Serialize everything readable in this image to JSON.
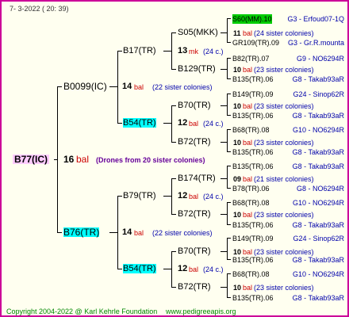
{
  "header": {
    "date": "7-  3-2022 ( 20: 39)"
  },
  "footer": {
    "copyright": "Copyright 2004-2022 @ Karl Kehrle Foundation",
    "url": "www.pedigreeapis.org"
  },
  "colors": {
    "border": "#cc0099",
    "background": "#fffff0",
    "highlight_cyan": "#00ffff",
    "highlight_green": "#00cc00",
    "highlight_pink": "#ffccff"
  },
  "root": {
    "name": "B77(IC)",
    "gen": "16",
    "unit": "bal",
    "note": "(Drones from 20 sister colonies)"
  },
  "gen1": [
    {
      "name": "B0099(IC)",
      "gen": "14",
      "unit": "bal",
      "note": "(22 sister colonies)"
    },
    {
      "name": "B76(TR)",
      "gen": "14",
      "unit": "bal",
      "note": "(22 sister colonies)"
    }
  ],
  "gen2": [
    {
      "name": "B17(TR)",
      "gen": "13",
      "unit": "mk",
      "note": "(24 c.)"
    },
    {
      "name": "B54(TR)",
      "gen": "12",
      "unit": "bal",
      "note": "(24 c.)"
    },
    {
      "name": "B79(TR)",
      "gen": "12",
      "unit": "bal",
      "note": "(24 c.)"
    },
    {
      "name": "B54(TR)",
      "gen": "12",
      "unit": "bal",
      "note": "(24 c.)"
    }
  ],
  "gen3": [
    {
      "name": "S05(MKK)",
      "gen": "11",
      "unit": "bal",
      "note": "(24 sister colonies)"
    },
    {
      "name": "B129(TR)",
      "gen": "10",
      "unit": "bal",
      "note": "(23 sister colonies)"
    },
    {
      "name": "B70(TR)",
      "gen": "10",
      "unit": "bal",
      "note": "(23 sister colonies)"
    },
    {
      "name": "B72(TR)",
      "gen": "10",
      "unit": "bal",
      "note": "(23 sister colonies)"
    },
    {
      "name": "B174(TR)",
      "gen": "09",
      "unit": "bal",
      "note": "(21 sister colonies)"
    },
    {
      "name": "B72(TR)",
      "gen": "10",
      "unit": "bal",
      "note": "(23 sister colonies)"
    },
    {
      "name": "B70(TR)",
      "gen": "10",
      "unit": "bal",
      "note": "(23 sister colonies)"
    },
    {
      "name": "B72(TR)",
      "gen": "10",
      "unit": "bal",
      "note": "(23 sister colonies)"
    }
  ],
  "gen4": [
    {
      "name": "S60(MM).10",
      "src": "G3 - Erfoud07-1Q"
    },
    {
      "name": "GR109(TR).09",
      "src": "G3 - Gr.R.mounta"
    },
    {
      "name": "B82(TR).07",
      "src": "G9 - NO6294R"
    },
    {
      "name": "B135(TR).06",
      "src": "G8 - Takab93aR"
    },
    {
      "name": "B149(TR).09",
      "src": "G24 - Sinop62R"
    },
    {
      "name": "B135(TR).06",
      "src": "G8 - Takab93aR"
    },
    {
      "name": "B68(TR).08",
      "src": "G10 - NO6294R"
    },
    {
      "name": "B135(TR).06",
      "src": "G8 - Takab93aR"
    },
    {
      "name": "B135(TR).06",
      "src": "G8 - Takab93aR"
    },
    {
      "name": "B78(TR).06",
      "src": "G8 - NO6294R"
    },
    {
      "name": "B68(TR).08",
      "src": "G10 - NO6294R"
    },
    {
      "name": "B135(TR).06",
      "src": "G8 - Takab93aR"
    },
    {
      "name": "B149(TR).09",
      "src": "G24 - Sinop62R"
    },
    {
      "name": "B135(TR).06",
      "src": "G8 - Takab93aR"
    },
    {
      "name": "B68(TR).08",
      "src": "G10 - NO6294R"
    },
    {
      "name": "B135(TR).06",
      "src": "G8 - Takab93aR"
    }
  ]
}
